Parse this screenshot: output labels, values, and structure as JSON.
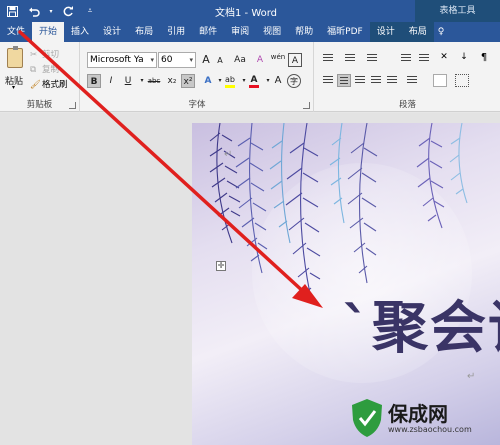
{
  "titlebar": {
    "title": "文档1 - Word",
    "context_title": "表格工具",
    "qat": {
      "save_icon": "save-icon",
      "undo_icon": "undo-icon",
      "redo_icon": "redo-icon",
      "customize_icon": "customize-qat-icon"
    }
  },
  "tabs": [
    "文件",
    "开始",
    "插入",
    "设计",
    "布局",
    "引用",
    "邮件",
    "审阅",
    "视图",
    "帮助",
    "福昕PDF",
    "设计",
    "布局"
  ],
  "active_tab": "开始",
  "clipboard": {
    "paste": "粘贴",
    "cut": "剪切",
    "copy": "复制",
    "format_painter": "格式刷",
    "label": "剪贴板"
  },
  "font": {
    "name": "Microsoft Ya",
    "size": "60",
    "grow": "A",
    "shrink": "A",
    "case": "Aa",
    "clear": "A",
    "phonetic": "wén",
    "border_char": "A",
    "bold": "B",
    "italic": "I",
    "underline": "U",
    "strike": "abc",
    "subscript": "x₂",
    "superscript": "x²",
    "highlight_color": "#ffff00",
    "font_color": "#e81123",
    "label": "字体"
  },
  "paragraph": {
    "label": "段落"
  },
  "document": {
    "heading": "`聚会请",
    "paragraph_mark": "↵"
  },
  "watermark": {
    "title": "保成网",
    "url": "www.zsbaochou.com"
  },
  "colors": {
    "brand": "#2b579a",
    "arrow": "#e0201e"
  }
}
